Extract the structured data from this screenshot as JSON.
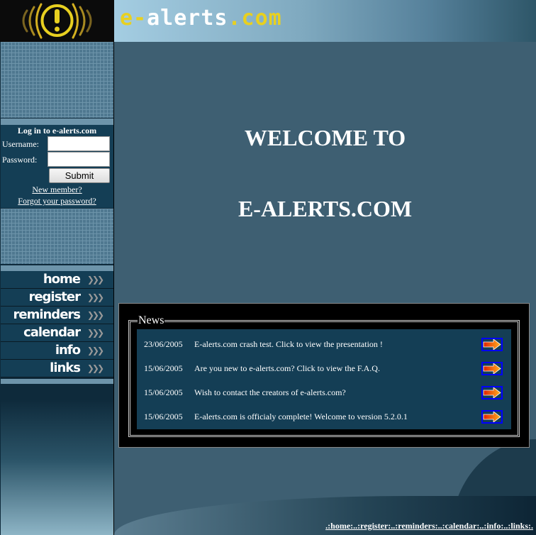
{
  "logo": {
    "text": "e-alerts.com",
    "icon": "warning-exclamation-icon"
  },
  "banner": {
    "part1": "e-",
    "part2": "alerts",
    "part3": ".com"
  },
  "login": {
    "title": "Log in to e-alerts.com",
    "username_label": "Username:",
    "password_label": "Password:",
    "username_value": "",
    "password_value": "",
    "submit": "Submit",
    "new_member": "New member?",
    "forgot": "Forgot your password?"
  },
  "nav": [
    {
      "label": "home"
    },
    {
      "label": "register"
    },
    {
      "label": "reminders"
    },
    {
      "label": "calendar"
    },
    {
      "label": "info"
    },
    {
      "label": "links"
    }
  ],
  "main": {
    "welcome1": "WELCOME TO",
    "welcome2": "E-ALERTS.COM"
  },
  "news": {
    "legend": "News",
    "items": [
      {
        "date": "23/06/2005",
        "text": "E-alerts.com crash test. Click to view the presentation !"
      },
      {
        "date": "15/06/2005",
        "text": "Are you new to e-alerts.com? Click to view the F.A.Q."
      },
      {
        "date": "15/06/2005",
        "text": "Wish to contact the creators of e-alerts.com?"
      },
      {
        "date": "15/06/2005",
        "text": "E-alerts.com is officialy complete! Welcome to version 5.2.0.1"
      }
    ]
  },
  "footer": {
    "links": ".:home:..:register:..:reminders:..:calendar:..:info:..:links:."
  },
  "colors": {
    "accent": "#e8d020",
    "panel": "#143e55",
    "main_bg": "#3e5f72"
  }
}
